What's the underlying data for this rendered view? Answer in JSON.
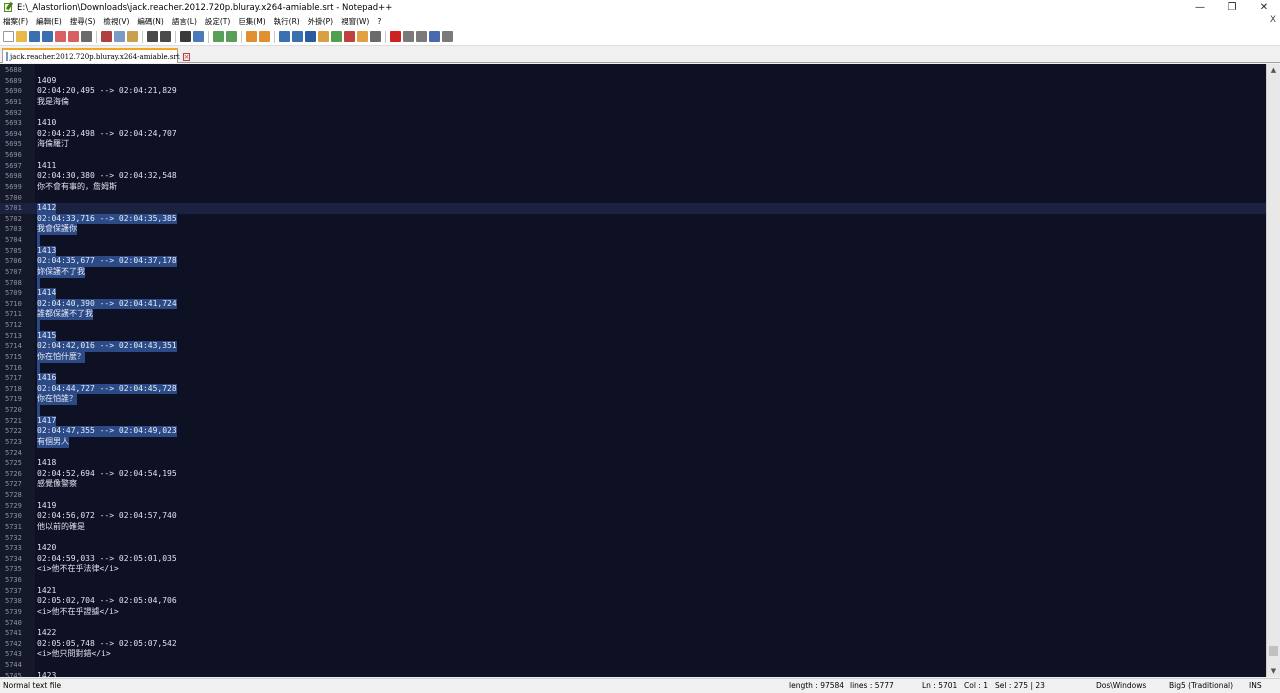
{
  "window": {
    "title": "E:\\_Alastorlion\\Downloads\\jack.reacher.2012.720p.bluray.x264-amiable.srt - Notepad++",
    "controls": {
      "minimize": "—",
      "maximize": "❐",
      "close": "✕"
    }
  },
  "menu": {
    "items": [
      "檔案(F)",
      "編輯(E)",
      "搜尋(S)",
      "檢視(V)",
      "編碼(N)",
      "語言(L)",
      "設定(T)",
      "巨集(M)",
      "執行(R)",
      "外掛(P)",
      "視窗(W)",
      "?"
    ],
    "close_glyph": "X"
  },
  "toolbar": {
    "icons": [
      {
        "name": "new-file-icon",
        "color": "#ffffff"
      },
      {
        "name": "open-file-icon",
        "color": "#e8b84a"
      },
      {
        "name": "save-icon",
        "color": "#3a6fb0"
      },
      {
        "name": "save-all-icon",
        "color": "#3a6fb0"
      },
      {
        "name": "close-icon",
        "color": "#d86060"
      },
      {
        "name": "close-all-icon",
        "color": "#d86060"
      },
      {
        "name": "print-icon",
        "color": "#6a6a6a"
      },
      {
        "name": "sep"
      },
      {
        "name": "cut-icon",
        "color": "#b04040"
      },
      {
        "name": "copy-icon",
        "color": "#7a9ac8"
      },
      {
        "name": "paste-icon",
        "color": "#c8a050"
      },
      {
        "name": "sep"
      },
      {
        "name": "undo-icon",
        "color": "#4a4a4a"
      },
      {
        "name": "redo-icon",
        "color": "#4a4a4a"
      },
      {
        "name": "sep"
      },
      {
        "name": "find-icon",
        "color": "#3a3a3a"
      },
      {
        "name": "replace-icon",
        "color": "#4a7ab8"
      },
      {
        "name": "sep"
      },
      {
        "name": "zoom-in-icon",
        "color": "#58a058"
      },
      {
        "name": "zoom-out-icon",
        "color": "#58a058"
      },
      {
        "name": "sep"
      },
      {
        "name": "sync-vertical-icon",
        "color": "#e09030"
      },
      {
        "name": "sync-horizontal-icon",
        "color": "#e09030"
      },
      {
        "name": "sep"
      },
      {
        "name": "word-wrap-icon",
        "color": "#3a6fb0"
      },
      {
        "name": "show-all-chars-icon",
        "color": "#3a6fb0"
      },
      {
        "name": "indent-guide-icon",
        "color": "#2a5aa0"
      },
      {
        "name": "user-lang-icon",
        "color": "#d8a040"
      },
      {
        "name": "doc-map-icon",
        "color": "#50a050"
      },
      {
        "name": "function-list-icon",
        "color": "#c04040"
      },
      {
        "name": "folder-workspace-icon",
        "color": "#e0a040"
      },
      {
        "name": "monitoring-icon",
        "color": "#6a6a6a"
      },
      {
        "name": "sep"
      },
      {
        "name": "record-macro-icon",
        "color": "#d02020"
      },
      {
        "name": "stop-record-icon",
        "color": "#7a7a7a"
      },
      {
        "name": "playback-icon",
        "color": "#7a7a7a"
      },
      {
        "name": "run-macro-multiple-icon",
        "color": "#4a6ab0"
      },
      {
        "name": "save-macro-icon",
        "color": "#7a7a7a"
      }
    ]
  },
  "tab": {
    "label": "jack.reacher.2012.720p.bluray.x264-amiable.srt",
    "close_glyph": "×"
  },
  "editor": {
    "colors": {
      "background": "#0e1124",
      "selection": "#2b4a86",
      "current_line": "#1a2240"
    },
    "lines": [
      {
        "n": "5688",
        "t": ""
      },
      {
        "n": "5689",
        "t": "1409"
      },
      {
        "n": "5690",
        "t": "02:04:20,495 --> 02:04:21,829"
      },
      {
        "n": "5691",
        "t": "我是海倫"
      },
      {
        "n": "5692",
        "t": ""
      },
      {
        "n": "5693",
        "t": "1410"
      },
      {
        "n": "5694",
        "t": "02:04:23,498 --> 02:04:24,707"
      },
      {
        "n": "5695",
        "t": "海倫羅汀"
      },
      {
        "n": "5696",
        "t": ""
      },
      {
        "n": "5697",
        "t": "1411"
      },
      {
        "n": "5698",
        "t": "02:04:30,380 --> 02:04:32,548"
      },
      {
        "n": "5699",
        "t": "你不會有事的，詹姆斯"
      },
      {
        "n": "5700",
        "t": ""
      },
      {
        "n": "5701",
        "t": "1412",
        "sel": true,
        "current": true
      },
      {
        "n": "5702",
        "t": "02:04:33,716 --> 02:04:35,385",
        "sel": true
      },
      {
        "n": "5703",
        "t": "我會保護你",
        "sel": true
      },
      {
        "n": "5704",
        "t": "",
        "sel": true
      },
      {
        "n": "5705",
        "t": "1413",
        "sel": true
      },
      {
        "n": "5706",
        "t": "02:04:35,677 --> 02:04:37,178",
        "sel": true
      },
      {
        "n": "5707",
        "t": "妳保護不了我",
        "sel": true
      },
      {
        "n": "5708",
        "t": "",
        "sel": true
      },
      {
        "n": "5709",
        "t": "1414",
        "sel": true
      },
      {
        "n": "5710",
        "t": "02:04:40,390 --> 02:04:41,724",
        "sel": true
      },
      {
        "n": "5711",
        "t": "誰都保護不了我",
        "sel": true
      },
      {
        "n": "5712",
        "t": "",
        "sel": true
      },
      {
        "n": "5713",
        "t": "1415",
        "sel": true
      },
      {
        "n": "5714",
        "t": "02:04:42,016 --> 02:04:43,351",
        "sel": true
      },
      {
        "n": "5715",
        "t": "你在怕什麼？",
        "sel": true
      },
      {
        "n": "5716",
        "t": "",
        "sel": true
      },
      {
        "n": "5717",
        "t": "1416",
        "sel": true
      },
      {
        "n": "5718",
        "t": "02:04:44,727 --> 02:04:45,728",
        "sel": true
      },
      {
        "n": "5719",
        "t": "你在怕誰？",
        "sel": true
      },
      {
        "n": "5720",
        "t": "",
        "sel": true
      },
      {
        "n": "5721",
        "t": "1417",
        "sel": true
      },
      {
        "n": "5722",
        "t": "02:04:47,355 --> 02:04:49,023",
        "sel": true
      },
      {
        "n": "5723",
        "t": "有個男人",
        "sel": true
      },
      {
        "n": "5724",
        "t": ""
      },
      {
        "n": "5725",
        "t": "1418"
      },
      {
        "n": "5726",
        "t": "02:04:52,694 --> 02:04:54,195"
      },
      {
        "n": "5727",
        "t": "感覺像警察"
      },
      {
        "n": "5728",
        "t": ""
      },
      {
        "n": "5729",
        "t": "1419"
      },
      {
        "n": "5730",
        "t": "02:04:56,072 --> 02:04:57,740"
      },
      {
        "n": "5731",
        "t": "他以前的確是"
      },
      {
        "n": "5732",
        "t": ""
      },
      {
        "n": "5733",
        "t": "1420"
      },
      {
        "n": "5734",
        "t": "02:04:59,033 --> 02:05:01,035"
      },
      {
        "n": "5735",
        "t": "<i>他不在乎法律</i>"
      },
      {
        "n": "5736",
        "t": ""
      },
      {
        "n": "5737",
        "t": "1421"
      },
      {
        "n": "5738",
        "t": "02:05:02,704 --> 02:05:04,706"
      },
      {
        "n": "5739",
        "t": "<i>他不在乎證據</i>"
      },
      {
        "n": "5740",
        "t": ""
      },
      {
        "n": "5741",
        "t": "1422"
      },
      {
        "n": "5742",
        "t": "02:05:05,748 --> 02:05:07,542"
      },
      {
        "n": "5743",
        "t": "<i>他只問對錯</i>"
      },
      {
        "n": "5744",
        "t": ""
      },
      {
        "n": "5745",
        "t": "1423"
      }
    ]
  },
  "scrollbar": {
    "up": "▲",
    "down": "▼",
    "position_fraction": 0.985
  },
  "status": {
    "type": "Normal text file",
    "length": "length : 97584",
    "lines": "lines : 5777",
    "ln": "Ln : 5701",
    "col": "Col : 1",
    "sel": "Sel : 275 | 23",
    "eol": "Dos\\Windows",
    "encoding": "Big5 (Traditional)",
    "mode": "INS"
  }
}
